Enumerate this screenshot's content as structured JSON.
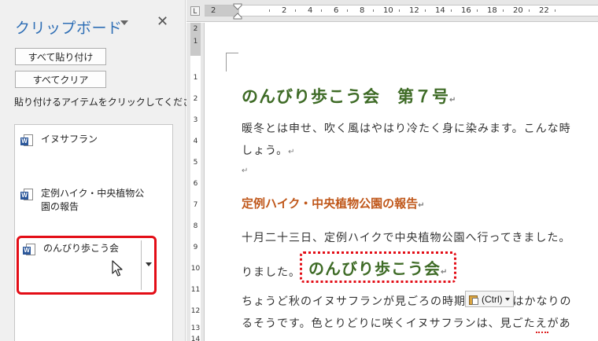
{
  "clipboard_pane": {
    "title": "クリップボード",
    "close_glyph": "✕",
    "paste_all_label": "すべて貼り付け",
    "clear_all_label": "すべてクリア",
    "hint": "貼り付けるアイテムをクリックしてください",
    "items": [
      {
        "label": "イヌサフラン",
        "icon": "word-doc-icon"
      },
      {
        "label": "定例ハイク・中央植物公園の報告",
        "icon": "word-doc-icon"
      },
      {
        "label": "のんびり歩こう会",
        "icon": "word-doc-icon",
        "selected": true
      }
    ],
    "highlight_color": "#e30d16"
  },
  "ruler": {
    "tab_selector": "L",
    "h_numbers": [
      "2",
      "2",
      "4",
      "6",
      "8",
      "10",
      "12",
      "14",
      "16",
      "18",
      "20",
      "22"
    ],
    "v_numbers": [
      "2",
      "1",
      "1",
      "2",
      "3",
      "4",
      "5",
      "6",
      "7",
      "8",
      "9",
      "10",
      "11",
      "12",
      "13",
      "14"
    ]
  },
  "document": {
    "title": "のんびり歩こう会　第７号",
    "para1_line1": "暖冬とは申せ、吹く風はやはり冷たく身に染みます。こんな時",
    "para1_line2": "しょう。",
    "heading2": "定例ハイク・中央植物公園の報告",
    "para2_line1": "十月二十三日、定例ハイクで中央植物公園へ行ってきました。",
    "para2_line2": "りました。",
    "pasted_text": "のんびり歩こう会",
    "para3_line1": "ちょうど秋のイヌサフランが見ごろの時期で、園内はかなりの",
    "para3_line2": "るそうです。色とりどりに咲くイヌサフランは、見ごたえがあ",
    "pilcrow": "↵",
    "title_color": "#3e6b26",
    "heading_color": "#c0581b"
  },
  "paste_options": {
    "label": "(Ctrl)",
    "icon": "clipboard-icon"
  }
}
